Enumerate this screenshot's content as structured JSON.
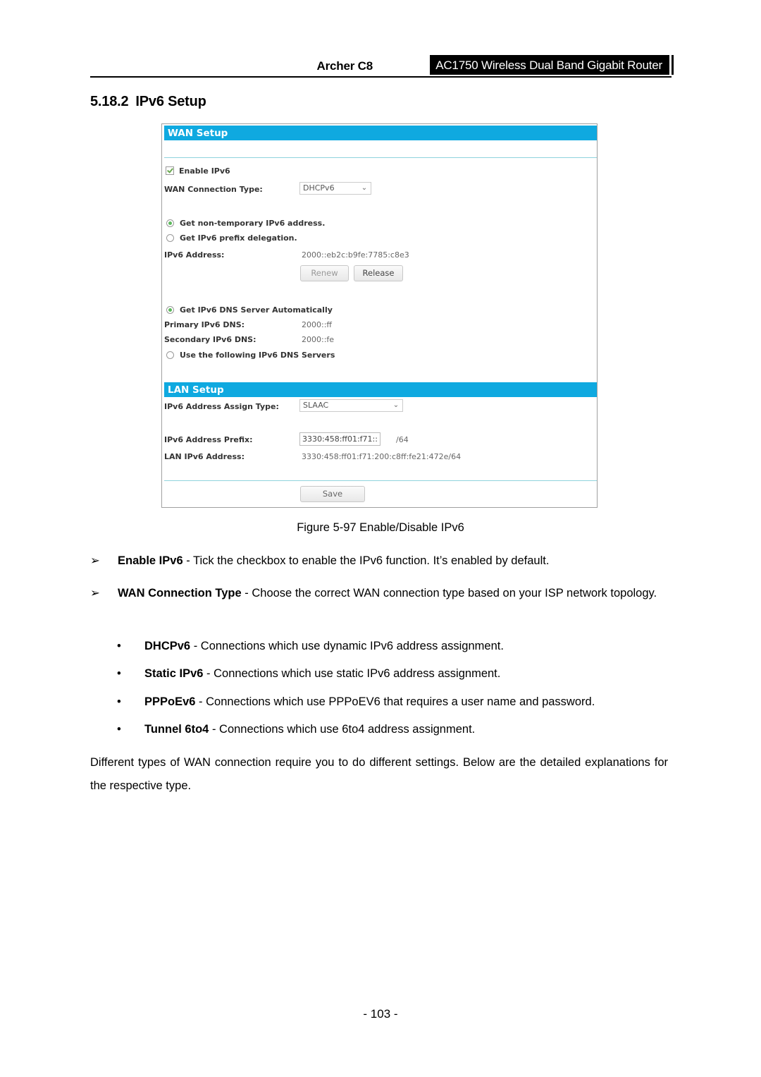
{
  "header": {
    "model": "Archer C8",
    "product": "AC1750 Wireless Dual Band Gigabit Router"
  },
  "section": {
    "number": "5.18.2",
    "title": "IPv6 Setup"
  },
  "figure": {
    "wan": {
      "title": "WAN Setup",
      "enable_label": "Enable IPv6",
      "enable_checked": true,
      "conn_type_label": "WAN Connection Type:",
      "conn_type_value": "DHCPv6",
      "addr_options": [
        {
          "label": "Get non-temporary IPv6 address.",
          "selected": true
        },
        {
          "label": "Get IPv6 prefix delegation.",
          "selected": false
        }
      ],
      "ipv6_address_label": "IPv6 Address:",
      "ipv6_address_value": "2000::eb2c:b9fe:7785:c8e3",
      "renew_label": "Renew",
      "release_label": "Release",
      "dns_auto_label": "Get IPv6 DNS Server Automatically",
      "dns_auto_selected": true,
      "primary_dns_label": "Primary IPv6 DNS:",
      "primary_dns_value": "2000::ff",
      "secondary_dns_label": "Secondary IPv6 DNS:",
      "secondary_dns_value": "2000::fe",
      "dns_manual_label": "Use the following IPv6 DNS Servers",
      "dns_manual_selected": false
    },
    "lan": {
      "title": "LAN Setup",
      "assign_type_label": "IPv6 Address Assign Type:",
      "assign_type_value": "SLAAC",
      "prefix_label": "IPv6 Address Prefix:",
      "prefix_value": "3330:458:ff01:f71::",
      "prefix_suffix": "/64",
      "lan_addr_label": "LAN IPv6 Address:",
      "lan_addr_value": "3330:458:ff01:f71:200:c8ff:fe21:472e/64"
    },
    "save_label": "Save",
    "caption": "Figure 5-97 Enable/Disable IPv6"
  },
  "bullets": [
    {
      "marker": "➢",
      "term": "Enable IPv6",
      "text": " - Tick the checkbox to enable the IPv6 function. It’s enabled by default."
    },
    {
      "marker": "➢",
      "term": "WAN Connection Type",
      "text": " - Choose the correct WAN connection type based on your ISP network topology."
    }
  ],
  "sub_bullets": [
    {
      "marker": "•",
      "term": "DHCPv6",
      "text": " - Connections which use dynamic IPv6 address assignment."
    },
    {
      "marker": "•",
      "term": "Static IPv6",
      "text": " - Connections which use static IPv6 address assignment."
    },
    {
      "marker": "•",
      "term": "PPPoEv6",
      "text": " - Connections which use PPPoEV6 that requires a user name and password."
    },
    {
      "marker": "•",
      "term": "Tunnel 6to4",
      "text": " - Connections which use 6to4 address assignment."
    }
  ],
  "paragraph": "Different types of WAN connection require you to do different settings. Below are the detailed explanations for the respective type.",
  "page_number": "- 103 -"
}
